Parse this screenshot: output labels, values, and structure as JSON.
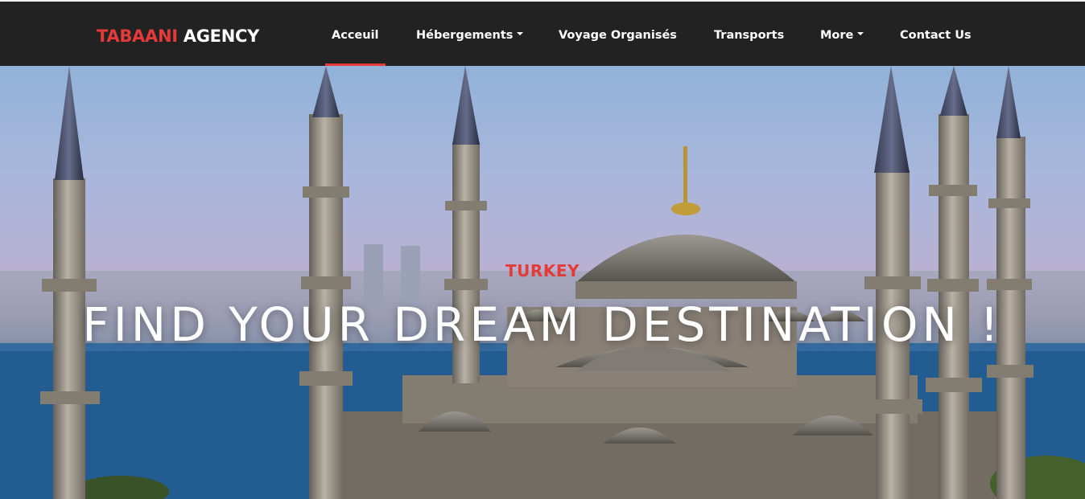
{
  "brand": {
    "part1": "TABAANI",
    "part2": "AGENCY"
  },
  "nav": {
    "items": [
      {
        "label": "Acceuil",
        "active": true,
        "has_dropdown": false
      },
      {
        "label": "Hébergements",
        "active": false,
        "has_dropdown": true
      },
      {
        "label": "Voyage Organisés",
        "active": false,
        "has_dropdown": false
      },
      {
        "label": "Transports",
        "active": false,
        "has_dropdown": false
      },
      {
        "label": "More",
        "active": false,
        "has_dropdown": true
      },
      {
        "label": "Contact Us",
        "active": false,
        "has_dropdown": false
      }
    ]
  },
  "hero": {
    "subtitle": "TURKEY",
    "title": "FIND YOUR DREAM DESTINATION !"
  },
  "colors": {
    "navbar_bg": "#222222",
    "accent": "#e53a3a",
    "text_light": "#ffffff"
  },
  "icons": [
    "chevron-down-icon"
  ]
}
